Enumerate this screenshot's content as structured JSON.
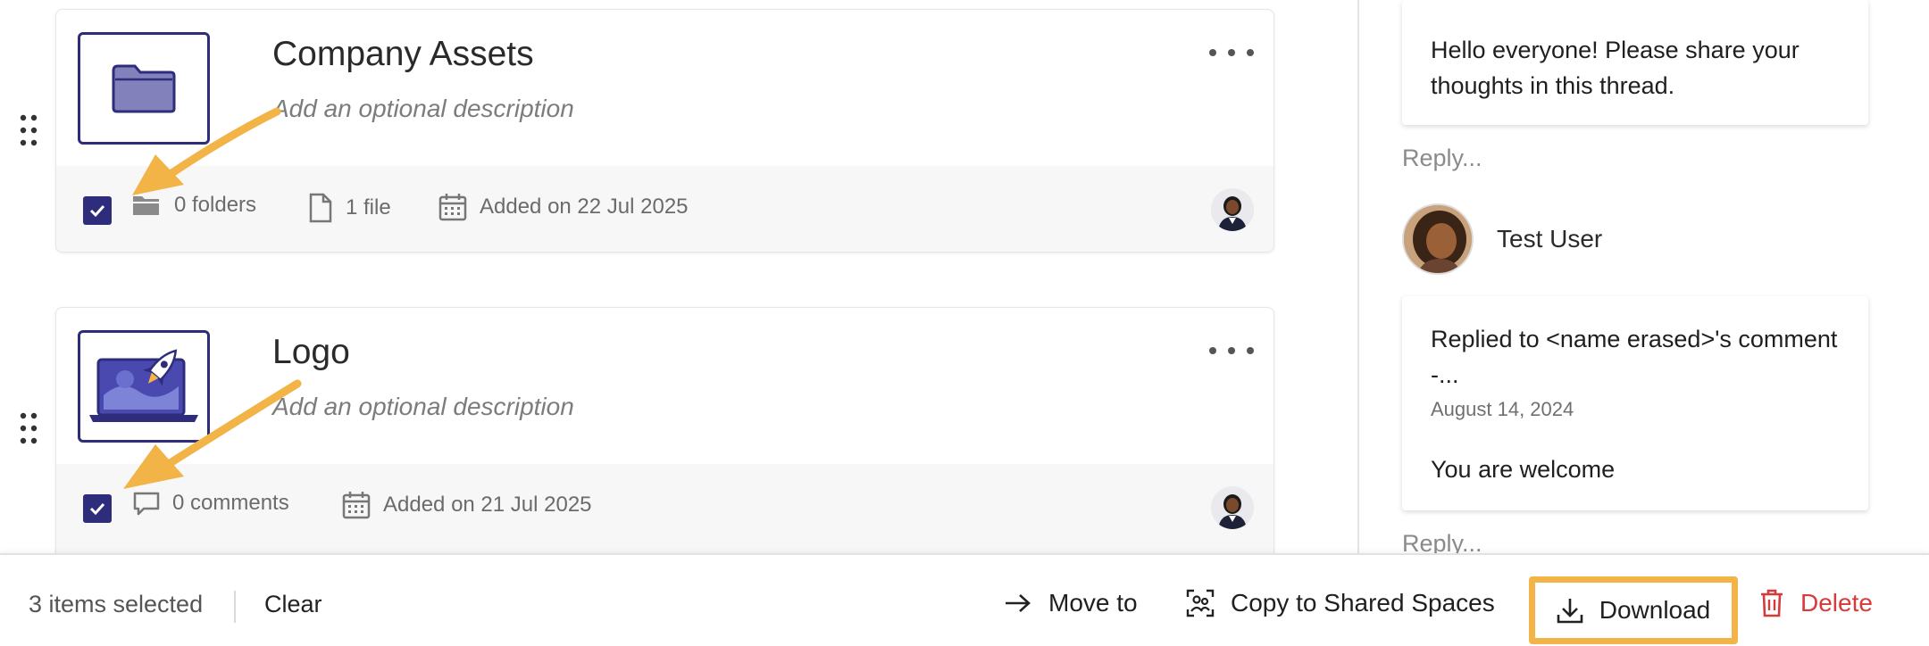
{
  "cards": [
    {
      "title": "Company Assets",
      "description_placeholder": "Add an optional description",
      "folders": "0 folders",
      "files": "1 file",
      "added": "Added on 22 Jul 2025"
    },
    {
      "title": "Logo",
      "description_placeholder": "Add an optional description",
      "comments": "0 comments",
      "added": "Added on 21 Jul 2025"
    }
  ],
  "comments_panel": {
    "first_comment": "Hello everyone! Please share your thoughts in this thread.",
    "reply_label": "Reply...",
    "user_name": "Test User",
    "second_comment": "Replied to <name erased>'s comment -...",
    "second_comment_date": "August 14, 2024",
    "second_comment_body": "You are welcome",
    "reply_label_2": "Reply..."
  },
  "action_bar": {
    "selected_count": "3 items selected",
    "clear_label": "Clear",
    "move_label": "Move to",
    "copy_label": "Copy to Shared Spaces",
    "download_label": "Download",
    "delete_label": "Delete"
  },
  "colors": {
    "brand": "#2e2d7c",
    "highlight": "#f2b347",
    "danger": "#d63a3a"
  }
}
